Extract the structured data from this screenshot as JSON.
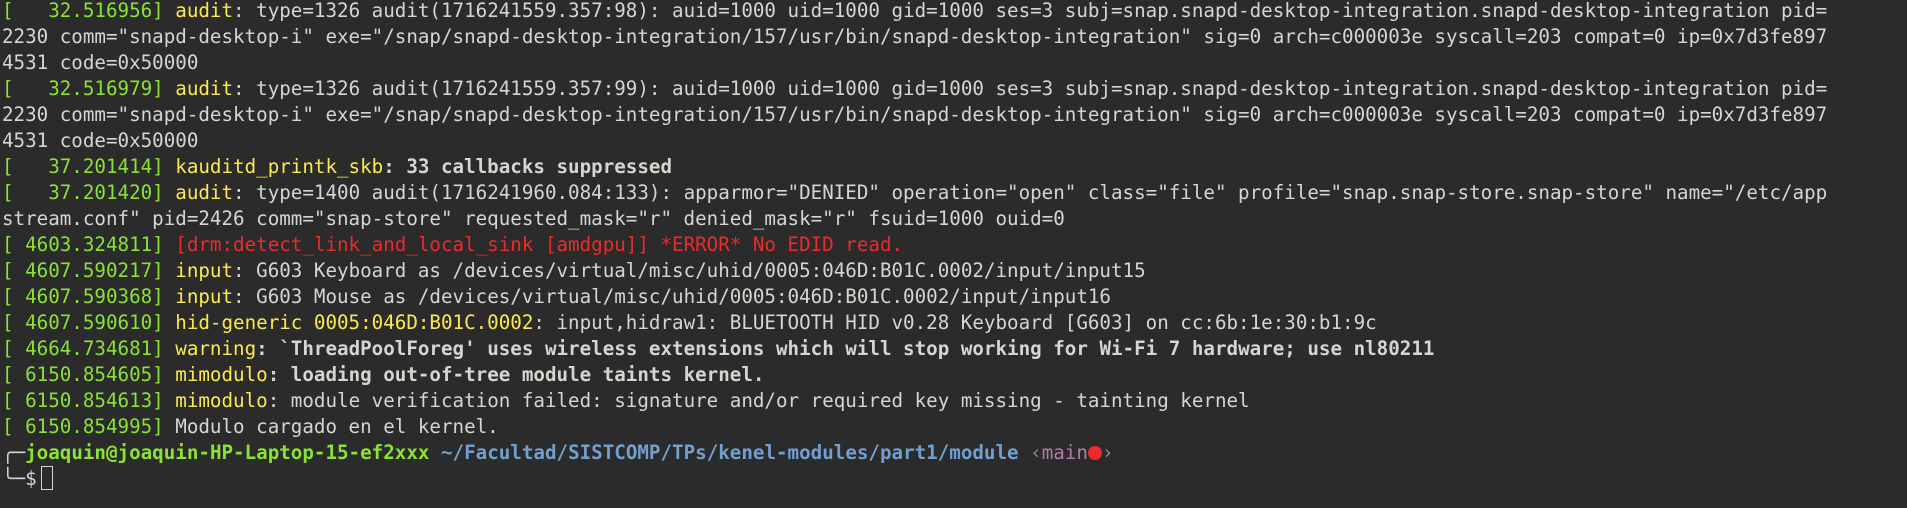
{
  "lines": [
    {
      "ts": "[   32.516956] ",
      "fac": "audit",
      "msg": ": type=1326 audit(1716241559.357:98): auid=1000 uid=1000 gid=1000 ses=3 subj=snap.snapd-desktop-integration.snapd-desktop-integration pid="
    },
    {
      "msg": "2230 comm=\"snapd-desktop-i\" exe=\"/snap/snapd-desktop-integration/157/usr/bin/snapd-desktop-integration\" sig=0 arch=c000003e syscall=203 compat=0 ip=0x7d3fe897"
    },
    {
      "msg": "4531 code=0x50000"
    },
    {
      "ts": "[   32.516979] ",
      "fac": "audit",
      "msg": ": type=1326 audit(1716241559.357:99): auid=1000 uid=1000 gid=1000 ses=3 subj=snap.snapd-desktop-integration.snapd-desktop-integration pid="
    },
    {
      "msg": "2230 comm=\"snapd-desktop-i\" exe=\"/snap/snapd-desktop-integration/157/usr/bin/snapd-desktop-integration\" sig=0 arch=c000003e syscall=203 compat=0 ip=0x7d3fe897"
    },
    {
      "msg": "4531 code=0x50000"
    },
    {
      "ts": "[   37.201414] ",
      "fac": "kauditd_printk_skb",
      "msg": ": 33 callbacks suppressed",
      "bold": true
    },
    {
      "ts": "[   37.201420] ",
      "fac": "audit",
      "msg": ": type=1400 audit(1716241960.084:133): apparmor=\"DENIED\" operation=\"open\" class=\"file\" profile=\"snap.snap-store.snap-store\" name=\"/etc/app"
    },
    {
      "msg": "stream.conf\" pid=2426 comm=\"snap-store\" requested_mask=\"r\" denied_mask=\"r\" fsuid=1000 ouid=0"
    },
    {
      "ts": "[ 4603.324811] ",
      "err": "[drm:detect_link_and_local_sink [amdgpu]] *ERROR* No EDID read."
    },
    {
      "ts": "[ 4607.590217] ",
      "fac": "input",
      "msg": ": G603 Keyboard as /devices/virtual/misc/uhid/0005:046D:B01C.0002/input/input15"
    },
    {
      "ts": "[ 4607.590368] ",
      "fac": "input",
      "msg": ": G603 Mouse as /devices/virtual/misc/uhid/0005:046D:B01C.0002/input/input16"
    },
    {
      "ts": "[ 4607.590610] ",
      "fac": "hid-generic 0005:046D:B01C.0002",
      "msg": ": input,hidraw1: BLUETOOTH HID v0.28 Keyboard [G603] on cc:6b:1e:30:b1:9c"
    },
    {
      "ts": "[ 4664.734681] ",
      "fac": "warning",
      "msg": ": `ThreadPoolForeg' uses wireless extensions which will stop working for Wi-Fi 7 hardware; use nl80211",
      "bold": true
    },
    {
      "ts": "[ 6150.854605] ",
      "fac": "mimodulo",
      "msg": ": loading out-of-tree module taints kernel.",
      "bold": true
    },
    {
      "ts": "[ 6150.854613] ",
      "fac": "mimodulo",
      "msg": ": module verification failed: signature and/or required key missing - tainting kernel"
    },
    {
      "ts": "[ 6150.854995] ",
      "msg": "Modulo cargado en el kernel."
    }
  ],
  "prompt": {
    "corner_top": "╭─",
    "user_host": "joaquin@joaquin-HP-Laptop-15-ef2xxx",
    "path": "~/Facultad/SISTCOMP/TPs/kenel-modules/part1/module",
    "branch_open": "‹main",
    "branch_close": "›",
    "corner_bottom": "╰─",
    "symbol": "$"
  },
  "colors": {
    "background": "#2b2b2b",
    "timestamp": "#8ae234",
    "facility": "#fce94f",
    "error": "#ef2929",
    "path": "#729fcf"
  }
}
